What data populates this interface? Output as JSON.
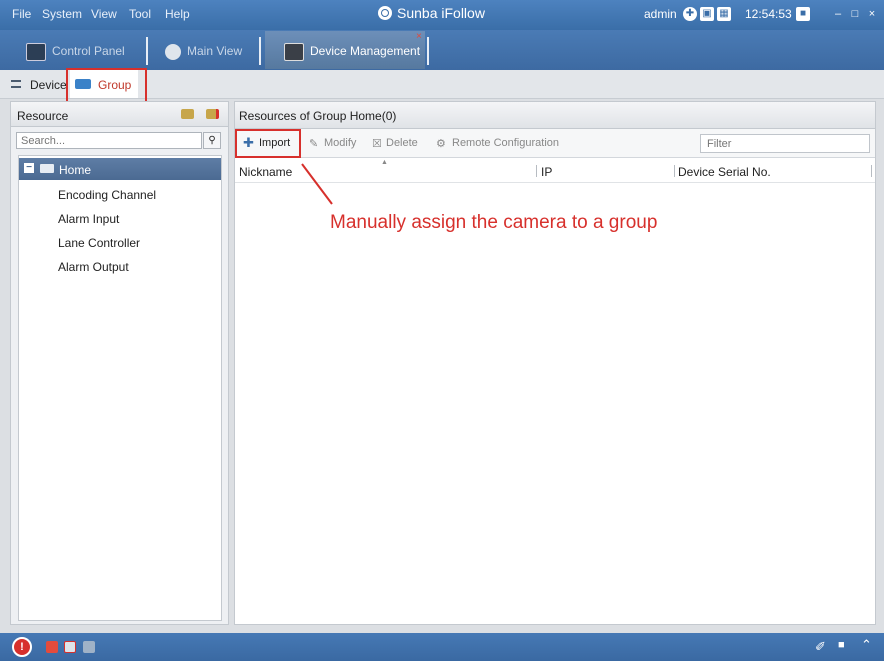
{
  "menu": [
    "File",
    "System",
    "View",
    "Tool",
    "Help"
  ],
  "app": {
    "title": "Sunba iFollow"
  },
  "titlebar": {
    "user": "admin",
    "time": "12:54:53"
  },
  "modules": [
    {
      "label": "Control Panel"
    },
    {
      "label": "Main View"
    },
    {
      "label": "Device Management"
    }
  ],
  "subtabs": {
    "device": "Device",
    "group": "Group"
  },
  "resource": {
    "title": "Resource",
    "search_placeholder": "Search...",
    "tree_root": "Home",
    "items": [
      "Encoding Channel",
      "Alarm Input",
      "Lane Controller",
      "Alarm Output"
    ]
  },
  "group": {
    "title": "Resources of Group Home(0)",
    "toolbar": {
      "import": "Import",
      "modify": "Modify",
      "delete": "Delete",
      "remote": "Remote Configuration"
    },
    "filter_placeholder": "Filter",
    "columns": [
      "Nickname",
      "IP",
      "Device Serial No."
    ]
  },
  "annotation": "Manually assign the camera to a group",
  "colors": {
    "accent": "#3a6ea8",
    "highlight": "#d7302c"
  }
}
